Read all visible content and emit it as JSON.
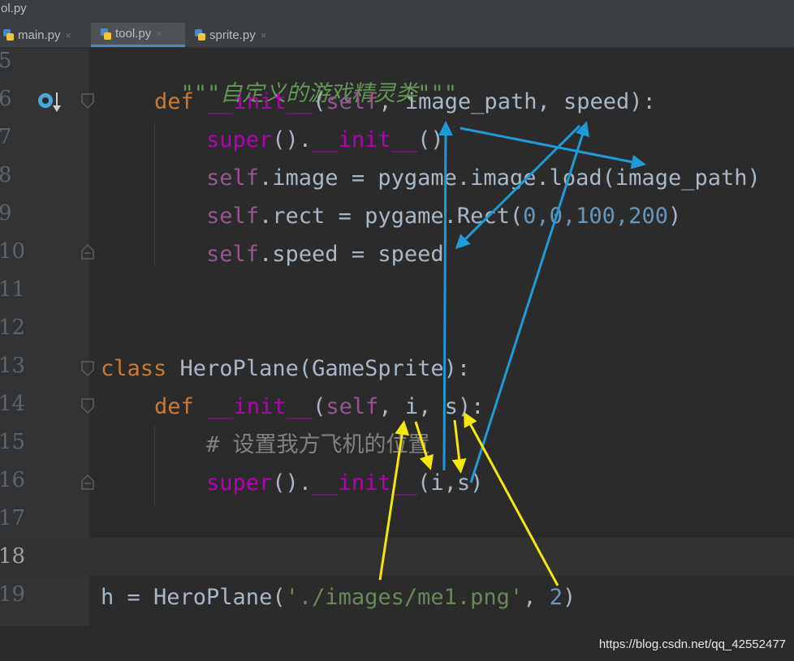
{
  "window": {
    "title": "ol.py"
  },
  "tabs": [
    {
      "label": "main.py",
      "close": "×"
    },
    {
      "label": "tool.py",
      "close": "×"
    },
    {
      "label": "sprite.py",
      "close": "×"
    }
  ],
  "line_numbers": [
    "5",
    "6",
    "7",
    "8",
    "9",
    "10",
    "11",
    "12",
    "13",
    "14",
    "15",
    "16",
    "17",
    "18",
    "19"
  ],
  "code": {
    "l5_doc": "\"\"\"自定义的游戏精灵类\"\"\"",
    "l6_def": "def",
    "l6_init": "__init__",
    "l6_paren": "(",
    "l6_self": "self",
    "l6_params": ", image_path, speed):",
    "l7_super": "super",
    "l7_call": "().",
    "l7_init": "__init__",
    "l7_end": "()",
    "l8_self": "self",
    "l8_rest": ".image = pygame.image.load(image_path)",
    "l9_self": "self",
    "l9_rest": ".rect = pygame.Rect(",
    "l9_nums": "0,0,100,200",
    "l9_end": ")",
    "l10_self": "self",
    "l10_rest": ".speed = speed",
    "l13_class": "class",
    "l13_rest": " HeroPlane(GameSprite):",
    "l14_def": "def",
    "l14_init": "__init__",
    "l14_paren": "(",
    "l14_self": "self",
    "l14_params": ", i, s):",
    "l15_comment": "# 设置我方飞机的位置",
    "l16_super": "super",
    "l16_call": "().",
    "l16_init": "__init__",
    "l16_args": "(i,s)",
    "l19_h": "h = HeroPlane(",
    "l19_str": "'./images/me1.png'",
    "l19_comma": ", ",
    "l19_num": "2",
    "l19_end": ")"
  },
  "watermark": "https://blog.csdn.net/qq_42552477",
  "colors": {
    "keyword": "#cc7832",
    "magic": "#b200b2",
    "self": "#94558d",
    "text": "#a9b7c6",
    "string": "#6a8759",
    "number": "#6897bb",
    "comment": "#808080",
    "docstring": "#629755",
    "arrow_blue": "#1e9ad6",
    "arrow_yellow": "#f5e60b"
  },
  "icons": {
    "gutter_marker": "override-breakpoint-icon",
    "fold": "fold-marker-icon"
  }
}
